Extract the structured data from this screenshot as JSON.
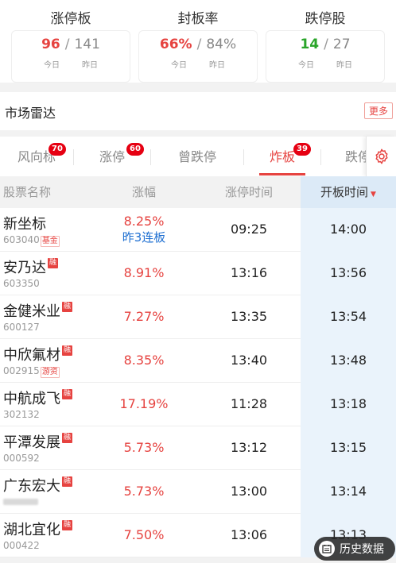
{
  "stats": [
    {
      "title": "涨停板",
      "today": "96",
      "yesterday": "141",
      "today_label": "今日",
      "yesterday_label": "昨日",
      "color": "#e64340"
    },
    {
      "title": "封板率",
      "today": "66%",
      "yesterday": "84%",
      "today_label": "今日",
      "yesterday_label": "昨日",
      "color": "#e64340"
    },
    {
      "title": "跌停股",
      "today": "14",
      "yesterday": "27",
      "today_label": "今日",
      "yesterday_label": "昨日",
      "color": "#2aa52a"
    }
  ],
  "radar": {
    "title": "市场雷达",
    "more_label": "更多"
  },
  "tabs": [
    {
      "label": "风向标",
      "badge": "70"
    },
    {
      "label": "涨停",
      "badge": "60"
    },
    {
      "label": "曾跌停",
      "badge": ""
    },
    {
      "label": "炸板",
      "badge": "39"
    },
    {
      "label": "跌停",
      "badge": ""
    }
  ],
  "active_tab": "炸板",
  "table": {
    "headers": {
      "name": "股票名称",
      "change": "涨幅",
      "limit_time": "涨停时间",
      "open_time": "开板时间"
    },
    "sort_indicator": "▼",
    "rows": [
      {
        "name": "新坐标",
        "code": "603040",
        "tag": "基金",
        "rong": "",
        "change": "8.25%",
        "streak": "昨3连板",
        "limit_time": "09:25",
        "open_time": "14:00"
      },
      {
        "name": "安乃达",
        "code": "603350",
        "tag": "",
        "rong": "融",
        "change": "8.91%",
        "streak": "",
        "limit_time": "13:16",
        "open_time": "13:56"
      },
      {
        "name": "金健米业",
        "code": "600127",
        "tag": "",
        "rong": "融",
        "change": "7.27%",
        "streak": "",
        "limit_time": "13:35",
        "open_time": "13:54"
      },
      {
        "name": "中欣氟材",
        "code": "002915",
        "tag": "游资",
        "rong": "融",
        "change": "8.35%",
        "streak": "",
        "limit_time": "13:40",
        "open_time": "13:48"
      },
      {
        "name": "中航成飞",
        "code": "302132",
        "tag": "",
        "rong": "融",
        "change": "17.19%",
        "streak": "",
        "limit_time": "11:28",
        "open_time": "13:18"
      },
      {
        "name": "平潭发展",
        "code": "000592",
        "tag": "",
        "rong": "融",
        "change": "5.73%",
        "streak": "",
        "limit_time": "13:12",
        "open_time": "13:15"
      },
      {
        "name": "广东宏大",
        "code": "",
        "tag": "",
        "rong": "融",
        "change": "5.73%",
        "streak": "",
        "limit_time": "13:00",
        "open_time": "13:14"
      },
      {
        "name": "湖北宜化",
        "code": "000422",
        "tag": "",
        "rong": "融",
        "change": "7.50%",
        "streak": "",
        "limit_time": "13:06",
        "open_time": "13:13"
      }
    ]
  },
  "history_button": {
    "label": "历史数据"
  },
  "colors": {
    "accent": "#e64340",
    "down": "#2aa52a",
    "link": "#1e6fd1",
    "highlight_col": "#eaf3fb"
  }
}
